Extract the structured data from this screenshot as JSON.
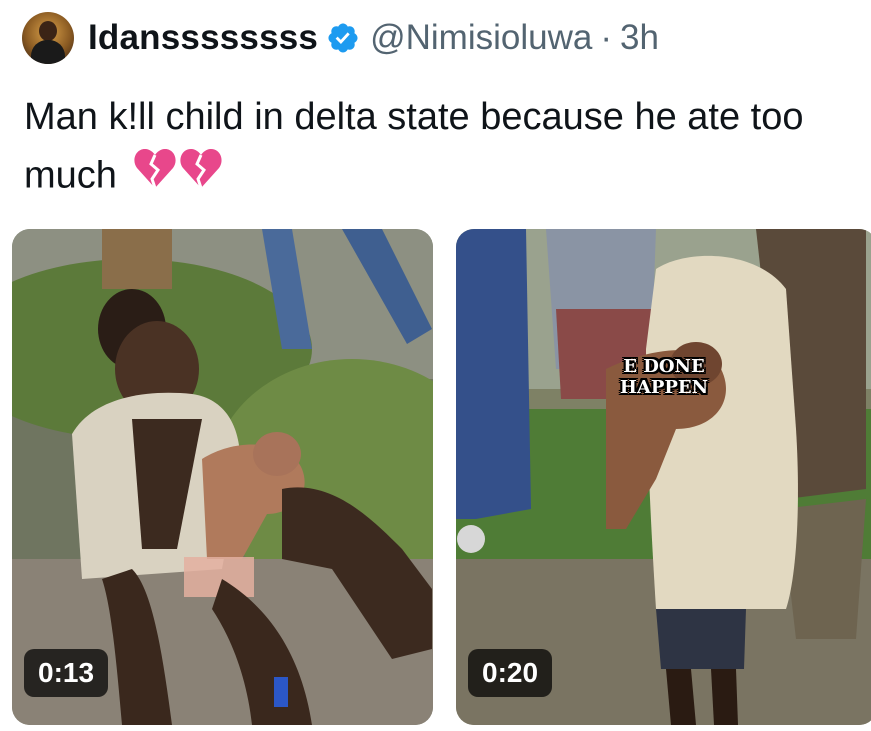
{
  "post": {
    "display_name": "Idanssssssss",
    "handle": "@Nimisioluwa",
    "separator": "·",
    "time": "3h",
    "text": "Man k!ll child in delta state because he ate too much"
  },
  "media": [
    {
      "duration": "0:13"
    },
    {
      "duration": "0:20",
      "caption": "E DONE HAPPEN"
    }
  ],
  "icons": {
    "verified": "verified-badge-icon",
    "emoji": "broken-heart-emoji"
  },
  "colors": {
    "verified_blue": "#1d9bf0",
    "secondary_text": "#536471",
    "broken_heart": "#e8478b"
  }
}
